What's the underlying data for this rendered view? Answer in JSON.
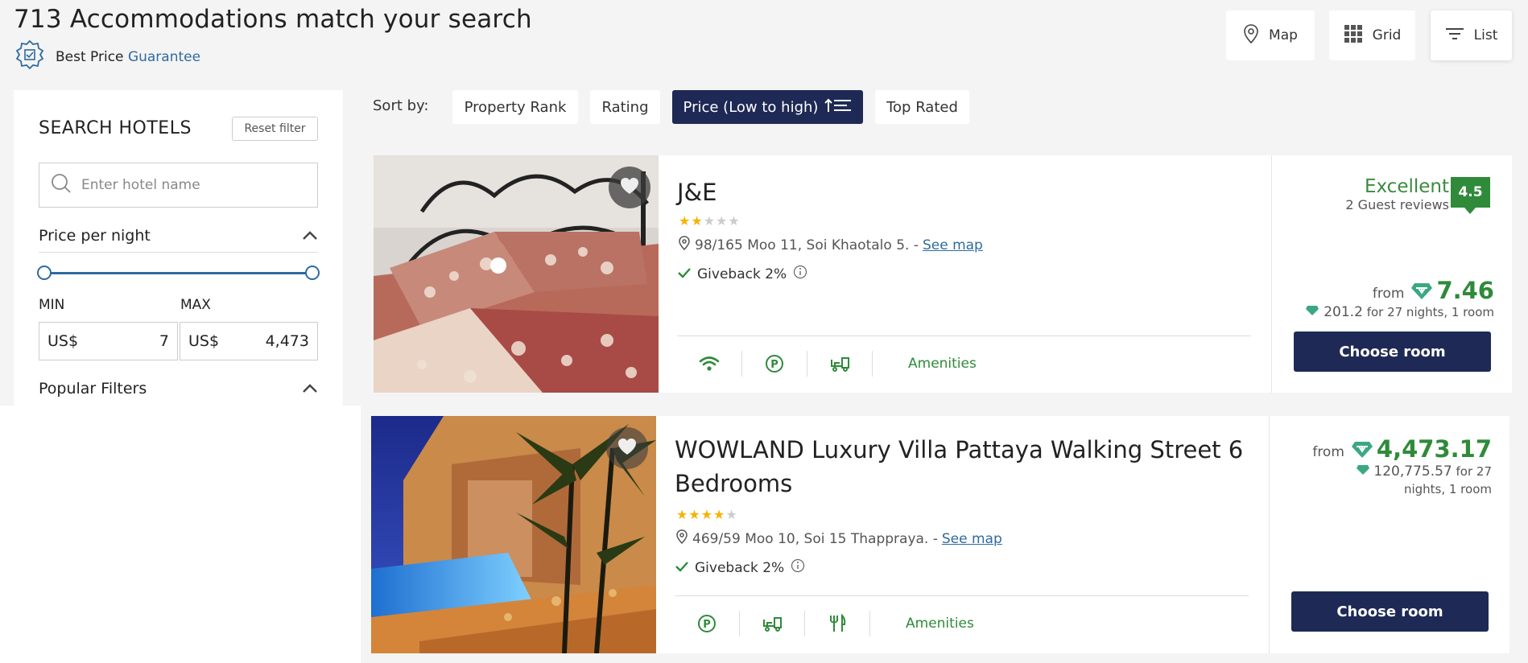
{
  "header": {
    "results_title": "713 Accommodations match your search",
    "guarantee_text": "Best Price",
    "guarantee_accent": "Guarantee",
    "views": [
      {
        "label": "Map",
        "icon": "map-pin-icon"
      },
      {
        "label": "Grid",
        "icon": "grid-icon"
      },
      {
        "label": "List",
        "icon": "list-icon"
      }
    ],
    "active_view": "List"
  },
  "sidebar": {
    "title": "SEARCH HOTELS",
    "reset_label": "Reset filter",
    "search_placeholder": "Enter hotel name",
    "price_title": "Price per night",
    "min_label": "MIN",
    "max_label": "MAX",
    "currency": "US$",
    "min_value": "7",
    "max_value": "4,473",
    "popular_title": "Popular Filters"
  },
  "sort": {
    "label": "Sort by:",
    "options": [
      "Property Rank",
      "Rating",
      "Price (Low to high)",
      "Top Rated"
    ],
    "active": "Price (Low to high)"
  },
  "hotels": [
    {
      "name": "J&E",
      "stars": 2,
      "address": "98/165 Moo 11, Soi Khaotalo 5. -",
      "map_link": "See map",
      "giveback": "Giveback 2%",
      "amenities": [
        "wifi-icon",
        "parking-icon",
        "airport-shuttle-icon"
      ],
      "amenities_label": "Amenities",
      "rating_word": "Excellent",
      "reviews": "2 Guest reviews",
      "score": "4.5",
      "from_label": "from",
      "price": "7.46",
      "total": "201.2",
      "total_suffix": "for 27 nights, 1 room",
      "cta": "Choose room"
    },
    {
      "name": "WOWLAND Luxury Villa Pattaya Walking Street 6 Bedrooms",
      "stars": 4,
      "address": "469/59 Moo 10, Soi 15 Thappraya. -",
      "map_link": "See map",
      "giveback": "Giveback 2%",
      "amenities": [
        "parking-icon",
        "airport-shuttle-icon",
        "restaurant-icon"
      ],
      "amenities_label": "Amenities",
      "from_label": "from",
      "price": "4,473.17",
      "total": "120,775.57",
      "total_suffix": "for 27 nights, 1 room",
      "cta": "Choose room"
    }
  ],
  "colors": {
    "accent_blue": "#2e6b9e",
    "navy": "#1e2a55",
    "green": "#2f8a3a",
    "star": "#f5b301"
  }
}
